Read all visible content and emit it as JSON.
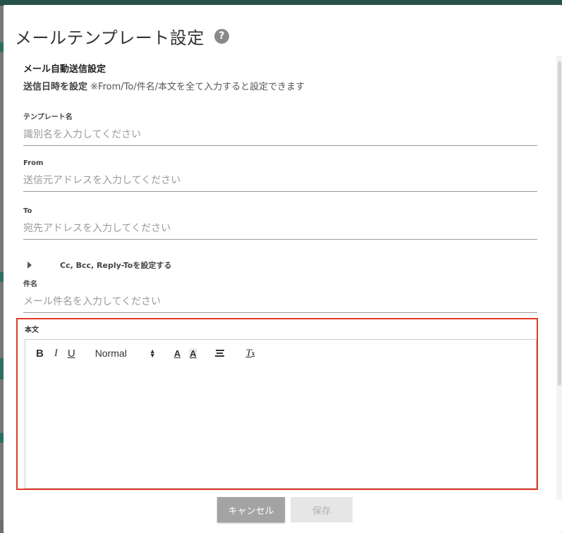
{
  "dialog": {
    "title": "メールテンプレート設定",
    "help_icon": "?"
  },
  "auto_send": {
    "section_title": "メール自動送信設定",
    "schedule_link": "送信日時を設定",
    "schedule_note": " ※From/To/件名/本文を全て入力すると設定できます"
  },
  "fields": {
    "template_name": {
      "label": "テンプレート名",
      "placeholder": "識別名を入力してください",
      "value": ""
    },
    "from": {
      "label": "From",
      "placeholder": "送信元アドレスを入力してください",
      "value": ""
    },
    "to": {
      "label": "To",
      "placeholder": "宛先アドレスを入力してください",
      "value": ""
    },
    "subject": {
      "label": "件名",
      "placeholder": "メール件名を入力してください",
      "value": ""
    }
  },
  "cc_toggle": {
    "label": "Cc, Bcc, Reply-Toを設定する",
    "icon": "caret-right-icon"
  },
  "body": {
    "label": "本文",
    "toolbar": {
      "bold": "B",
      "italic": "I",
      "underline": "U",
      "header_select": "Normal",
      "color": "A",
      "background": "A",
      "clean": "T",
      "clean_sub": "x"
    },
    "content": ""
  },
  "footer": {
    "cancel_label": "キャンセル",
    "save_label": "保存"
  },
  "colors": {
    "highlight_border": "#e03b2a",
    "cancel_bg": "#a3a3a3",
    "save_bg": "#e6e6e6",
    "backdrop_accent": "#2e6e62"
  }
}
